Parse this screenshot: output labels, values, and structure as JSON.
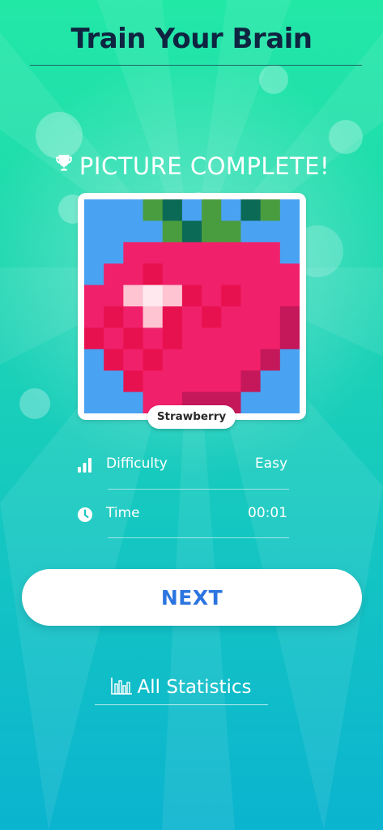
{
  "app": {
    "title": "Train Your Brain"
  },
  "result": {
    "heading": "PICTURE COMPLETE!",
    "picture_name": "Strawberry",
    "picture_pixels": [
      [
        "B",
        "B",
        "B",
        "G",
        "D",
        "B",
        "G",
        "B",
        "D",
        "G",
        "B"
      ],
      [
        "B",
        "B",
        "B",
        "B",
        "G",
        "D",
        "G",
        "G",
        "B",
        "B",
        "B"
      ],
      [
        "B",
        "B",
        "R",
        "R",
        "R",
        "R",
        "R",
        "R",
        "R",
        "R",
        "B"
      ],
      [
        "B",
        "R",
        "R",
        "r",
        "R",
        "R",
        "R",
        "R",
        "R",
        "R",
        "R"
      ],
      [
        "R",
        "R",
        "p",
        "W",
        "p",
        "r",
        "R",
        "r",
        "R",
        "R",
        "R"
      ],
      [
        "R",
        "r",
        "R",
        "p",
        "r",
        "R",
        "r",
        "R",
        "R",
        "R",
        "m"
      ],
      [
        "r",
        "R",
        "r",
        "R",
        "r",
        "R",
        "R",
        "R",
        "R",
        "R",
        "m"
      ],
      [
        "B",
        "r",
        "R",
        "r",
        "R",
        "R",
        "R",
        "R",
        "R",
        "m",
        "B"
      ],
      [
        "B",
        "B",
        "r",
        "R",
        "R",
        "R",
        "R",
        "R",
        "m",
        "B",
        "B"
      ],
      [
        "B",
        "B",
        "B",
        "R",
        "R",
        "m",
        "m",
        "m",
        "B",
        "B",
        "B"
      ]
    ],
    "palette": {
      "B": "#4aa2f2",
      "G": "#4a9d3e",
      "D": "#0b6a56",
      "R": "#f0206a",
      "r": "#e8114f",
      "p": "#ffc4d2",
      "W": "#ffe9ee",
      "m": "#c4185a"
    }
  },
  "stats": {
    "difficulty_label": "Difficulty",
    "difficulty_value": "Easy",
    "time_label": "Time",
    "time_value": "00:01"
  },
  "actions": {
    "next_label": "NEXT",
    "all_stats_label": "All Statistics"
  }
}
